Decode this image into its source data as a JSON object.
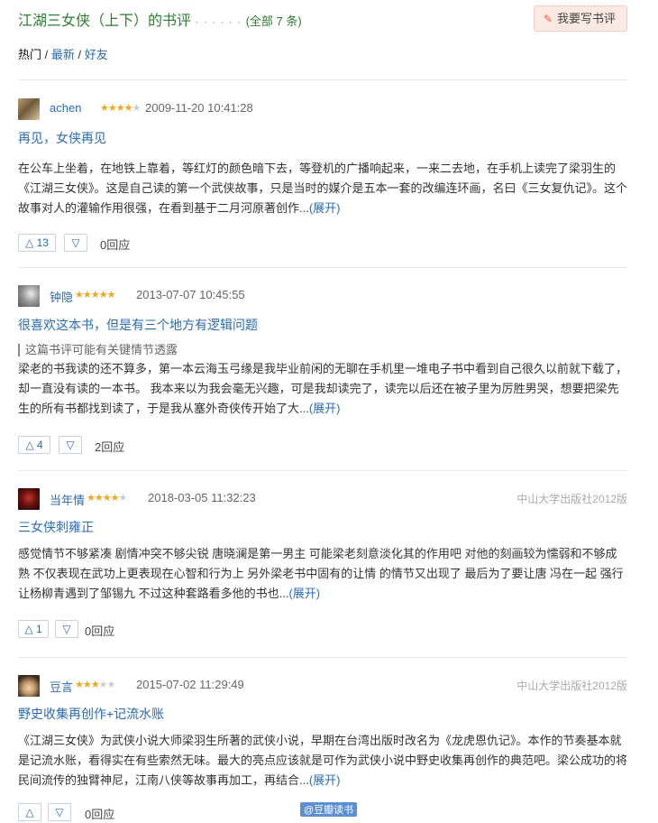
{
  "header": {
    "title": "江湖三女侠（上下）的书评",
    "dots": "· · · · · ·",
    "count": "(全部 7 条)",
    "write_button": "我要写书评",
    "write_icon": "pencil-icon"
  },
  "tabs": {
    "hot": "热门",
    "sep1": " / ",
    "latest": "最新",
    "sep2": " / ",
    "friends": "好友"
  },
  "reviews": [
    {
      "user": "achen",
      "rating": 4,
      "time": "2009-11-20 10:41:28",
      "publisher": "",
      "title": "再见，女侠再见",
      "spoiler": "",
      "body": "在公车上坐着，在地铁上靠着，等红灯的颜色暗下去，等登机的广播响起来，一来二去地，在手机上读完了梁羽生的《江湖三女侠》。这是自己读的第一个武侠故事，只是当时的媒介是五本一套的改编连环画，名曰《三女复仇记》。这个故事对人的灌输作用很强，在看到基于二月河原著创作...",
      "more": "(展开)",
      "up": "13",
      "replies": "0回应"
    },
    {
      "user": "钟隐",
      "rating": 5,
      "time": "2013-07-07 10:45:55",
      "publisher": "",
      "title": "很喜欢这本书，但是有三个地方有逻辑问题",
      "spoiler": "这篇书评可能有关键情节透露",
      "body": "梁老的书我读的还不算多，第一本云海玉弓缘是我毕业前闲的无聊在手机里一堆电子书中看到自己很久以前就下载了，却一直没有读的一本书。 我本来以为我会毫无兴趣，可是我却读完了，读完以后还在被子里为厉胜男哭，想要把梁先生的所有书都找到读了，于是我从塞外奇侠传开始了大...",
      "more": "(展开)",
      "up": "4",
      "replies": "2回应"
    },
    {
      "user": "当年情",
      "rating": 4,
      "time": "2018-03-05 11:32:23",
      "publisher": "中山大学出版社2012版",
      "title": "三女侠刺雍正",
      "spoiler": "",
      "body": "感觉情节不够紧凑 剧情冲突不够尖锐 唐晓澜是第一男主 可能梁老刻意淡化其的作用吧 对他的刻画较为懦弱和不够成熟 不仅表现在武功上更表现在心智和行为上 另外梁老书中固有的让情 的情节又出现了 最后为了要让唐 冯在一起 强行让杨柳青遇到了邹锡九 不过这种套路看多他的书也...",
      "more": "(展开)",
      "up": "1",
      "replies": "0回应"
    },
    {
      "user": "豆言",
      "rating": 3,
      "time": "2015-07-02 11:29:49",
      "publisher": "中山大学出版社2012版",
      "title": "野史收集再创作+记流水账",
      "spoiler": "",
      "body": "《江湖三女侠》为武侠小说大师梁羽生所著的武侠小说，早期在台湾出版时改名为《龙虎恩仇记》。本作的节奏基本就是记流水账，看得实在有些索然无味。最大的亮点应该就是可作为武侠小说中野史收集再创作的典范吧。梁公成功的将民间流传的独臂神尼，江南八侠等故事再加工，再结合...",
      "more": "(展开)",
      "up": "",
      "replies": "0回应"
    }
  ],
  "watermark": "@豆瓣读书"
}
